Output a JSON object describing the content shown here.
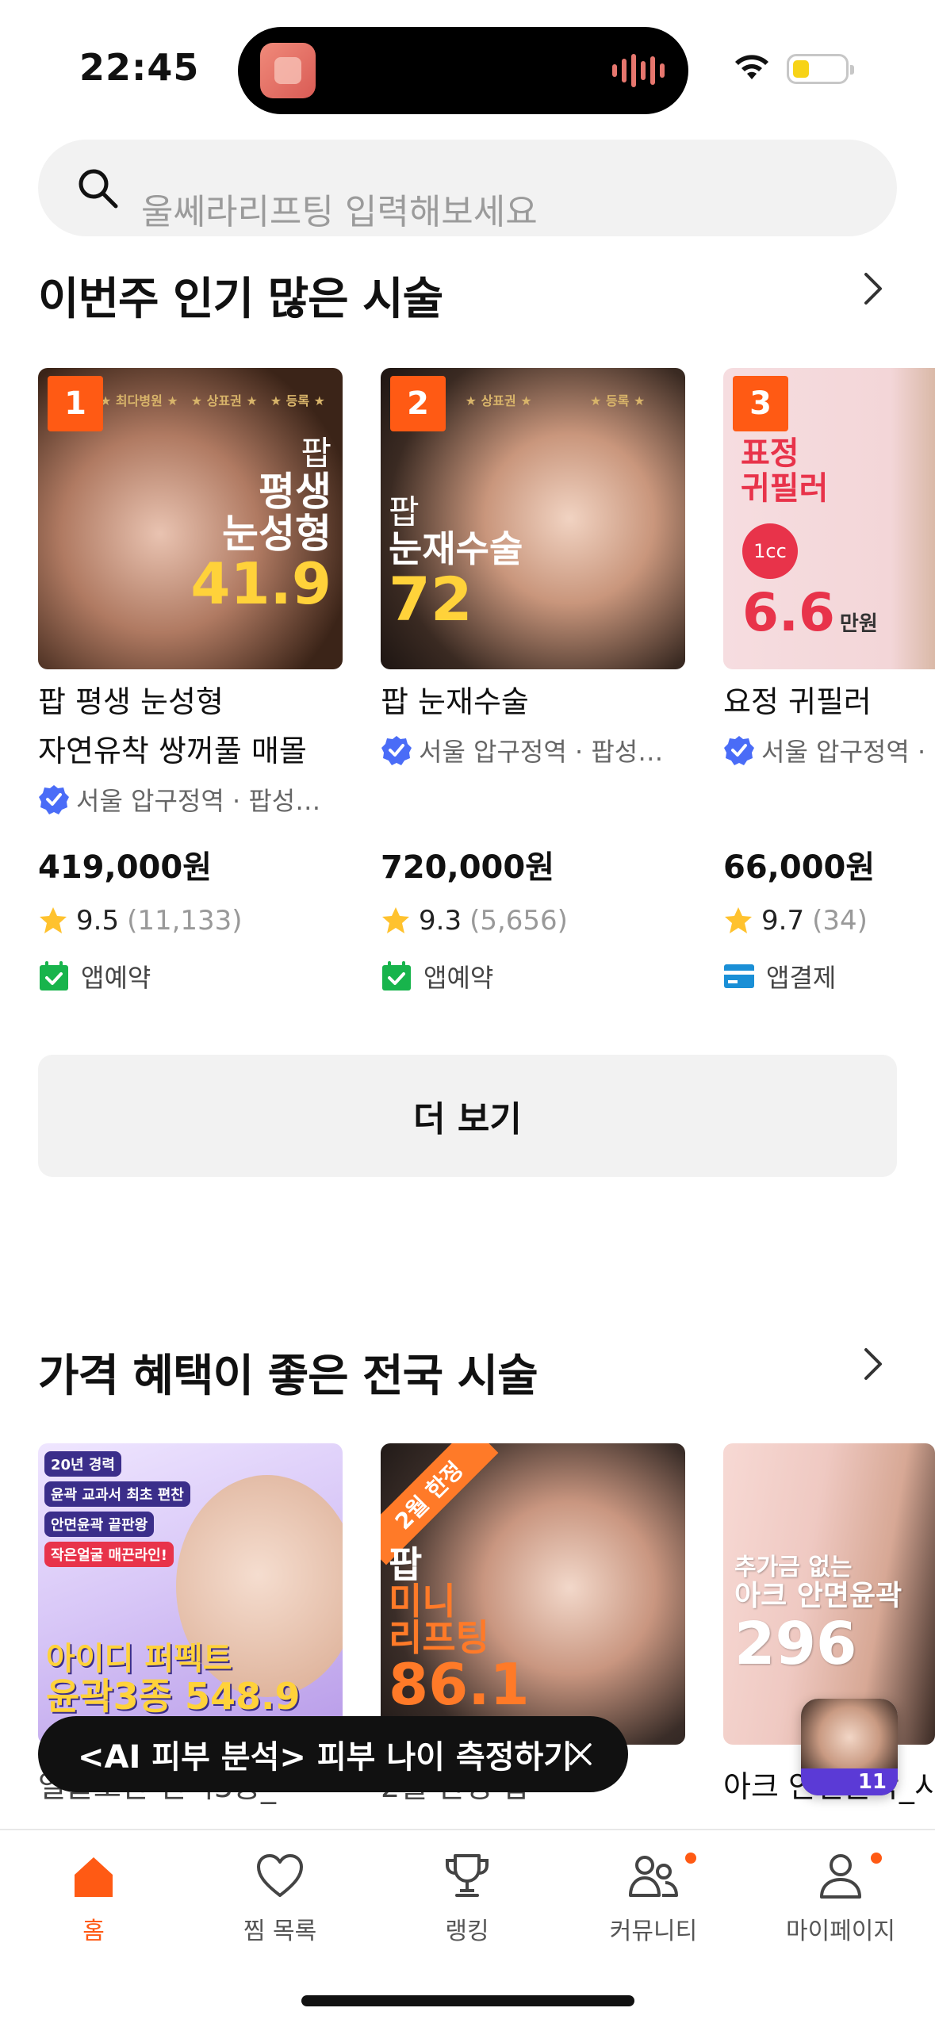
{
  "status_bar": {
    "time": "22:45"
  },
  "search": {
    "placeholder": "울쎄라리프팅 입력해보세요"
  },
  "popular": {
    "title": "이번주 인기 많은 시술",
    "more_label": "더 보기",
    "items": [
      {
        "rank": "1",
        "thumb_text": [
          "팝",
          "평생",
          "눈성형",
          "41.9"
        ],
        "name_line1": "팝 평생 눈성형",
        "name_line2": "자연유착 쌍꺼풀 매몰",
        "location": "서울 압구정역 · 팝성…",
        "price": "419,000원",
        "rating": "9.5",
        "review_count": "(11,133)",
        "pay_type": "앱예약",
        "pay_icon": "calendar-check-icon",
        "accent": "#ffd23a"
      },
      {
        "rank": "2",
        "thumb_text": [
          "팝",
          "눈재수술",
          "72"
        ],
        "name_line1": "팝 눈재수술",
        "location": "서울 압구정역 · 팝성…",
        "price": "720,000원",
        "rating": "9.3",
        "review_count": "(5,656)",
        "pay_type": "앱예약",
        "pay_icon": "calendar-check-icon",
        "accent": "#ffd23a"
      },
      {
        "rank": "3",
        "thumb_text": [
          "표정",
          "귀필러",
          "1cc",
          "6.6",
          "만원"
        ],
        "name_line1": "요정 귀필러",
        "location": "서울 압구정역 ·",
        "price": "66,000원",
        "rating": "9.7",
        "review_count": "(34)",
        "pay_type": "앱결제",
        "pay_icon": "card-icon",
        "accent": "#e8334a"
      }
    ]
  },
  "deals": {
    "title": "가격 혜택이 좋은 전국 시술",
    "items": [
      {
        "thumb_text": [
          "20년 경력",
          "윤곽 교과서 최초 편찬",
          "안면윤곽 끝판왕",
          "작은얼굴 매끈라인!",
          "아이디 퍼펙트",
          "윤곽3종 548.9"
        ],
        "caption": "얼굴조판 연식3종_"
      },
      {
        "thumb_text": [
          "2월 한정",
          "팝",
          "미니",
          "리프팅",
          "86.1"
        ],
        "caption": "2월 한정 팝"
      },
      {
        "thumb_text": [
          "추가금 없는",
          "아크 안면윤곽",
          "296"
        ],
        "caption": "아크 안면윤곽_시"
      }
    ]
  },
  "toast": {
    "text": "<AI 피부 분석> 피부 나이 측정하기"
  },
  "floating_badge": {
    "text": "11"
  },
  "bottom_nav": [
    {
      "label": "홈",
      "icon": "home-icon",
      "active": true
    },
    {
      "label": "찜 목록",
      "icon": "heart-icon"
    },
    {
      "label": "랭킹",
      "icon": "trophy-icon"
    },
    {
      "label": "커뮤니티",
      "icon": "community-icon",
      "badge": true
    },
    {
      "label": "마이페이지",
      "icon": "profile-icon",
      "badge": true
    }
  ],
  "colors": {
    "brand": "#ff5a14",
    "verified": "#4a6cf7",
    "star": "#ffc22e",
    "calendar": "#18b44c",
    "card": "#1a8fd6"
  }
}
